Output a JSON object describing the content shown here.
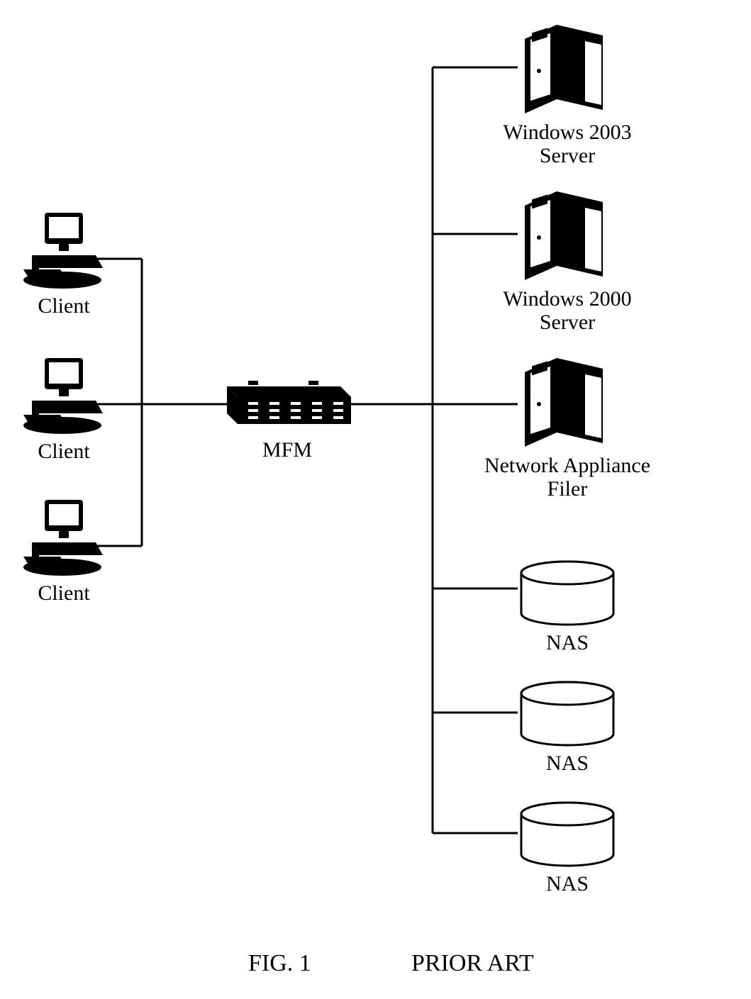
{
  "clients": [
    {
      "label": "Client"
    },
    {
      "label": "Client"
    },
    {
      "label": "Client"
    }
  ],
  "center": {
    "label": "MFM"
  },
  "right": {
    "server1": "Windows 2003\nServer",
    "server2": "Windows 2000\nServer",
    "server3": "Network Appliance\nFiler",
    "nas1": "NAS",
    "nas2": "NAS",
    "nas3": "NAS"
  },
  "caption": {
    "fig": "FIG. 1",
    "prior": "PRIOR ART"
  }
}
